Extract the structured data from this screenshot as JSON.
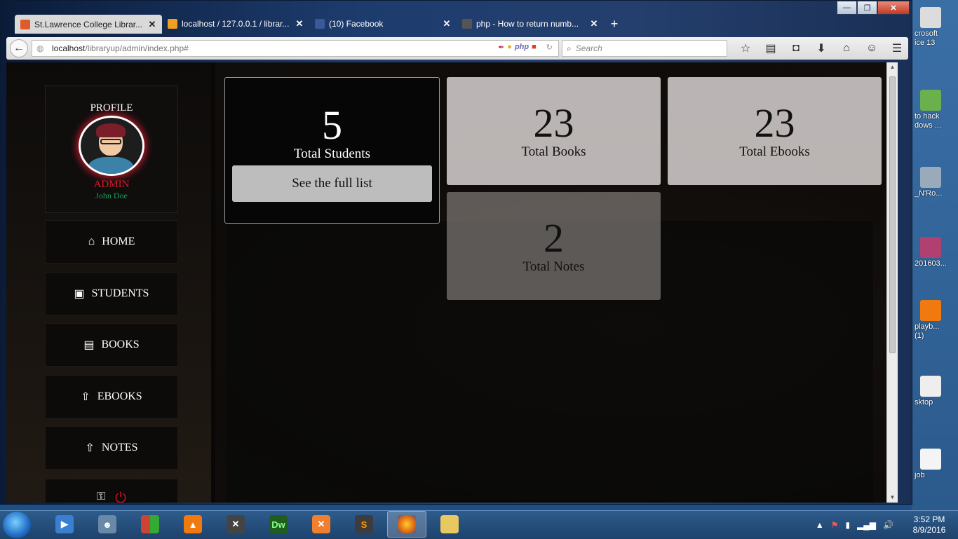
{
  "desktop": {
    "icons": [
      "crosoft\nice 13",
      "to hack\ndows ...",
      "_N'Ro...",
      "201603...",
      "playb...\n(1)",
      "sktop",
      "job"
    ]
  },
  "browser": {
    "tabs": [
      {
        "label": "St.Lawrence College Librar...",
        "favicon_color": "#e05a2a"
      },
      {
        "label": "localhost / 127.0.0.1 / librar...",
        "favicon_color": "#f0a020"
      },
      {
        "label": "(10) Facebook",
        "favicon_color": "#3b5998"
      },
      {
        "label": "php - How to return numb...",
        "favicon_color": "#555555"
      }
    ],
    "new_tab": "+",
    "url_host": "localhost",
    "url_path": "/libraryup/admin/index.php#",
    "search_placeholder": "Search",
    "url_badge": "php"
  },
  "sidebar": {
    "profile_title": "PROFILE",
    "role": "ADMIN",
    "username": "John Doe",
    "menu": [
      {
        "label": "HOME",
        "icon": "home-icon",
        "glyph": "⌂"
      },
      {
        "label": "STUDENTS",
        "icon": "students-icon",
        "glyph": "▣"
      },
      {
        "label": "BOOKS",
        "icon": "books-icon",
        "glyph": "▤"
      },
      {
        "label": "EBOOKS",
        "icon": "upload-icon",
        "glyph": "⇧"
      },
      {
        "label": "NOTES",
        "icon": "upload-icon",
        "glyph": "⇧"
      }
    ]
  },
  "stats": {
    "students": {
      "value": "5",
      "label": "Total Students",
      "button": "See the full list"
    },
    "books": {
      "value": "23",
      "label": "Total Books"
    },
    "ebooks": {
      "value": "23",
      "label": "Total Ebooks"
    },
    "notes": {
      "value": "2",
      "label": "Total Notes"
    }
  },
  "taskbar": {
    "apps": [
      {
        "icon": "media-player-icon",
        "color": "#3a7fd0",
        "active": false
      },
      {
        "icon": "user-icon",
        "color": "#6a88a8",
        "active": false
      },
      {
        "icon": "microsoft-office-icon",
        "color": "#c43",
        "active": false
      },
      {
        "icon": "vlc-icon",
        "color": "#f07a10",
        "active": false
      },
      {
        "icon": "xampp-tools-icon",
        "color": "#555",
        "active": false
      },
      {
        "icon": "dreamweaver-icon",
        "color": "#1f5e1f",
        "text": "Dw",
        "active": false
      },
      {
        "icon": "xampp-icon",
        "color": "#f08030",
        "active": false
      },
      {
        "icon": "sublime-text-icon",
        "color": "#3d3d3d",
        "text": "S",
        "active": false
      },
      {
        "icon": "firefox-icon",
        "color": "#e06a10",
        "active": true
      },
      {
        "icon": "file-explorer-icon",
        "color": "#e8c860",
        "active": false
      }
    ],
    "time": "3:52 PM",
    "date": "8/9/2016"
  }
}
